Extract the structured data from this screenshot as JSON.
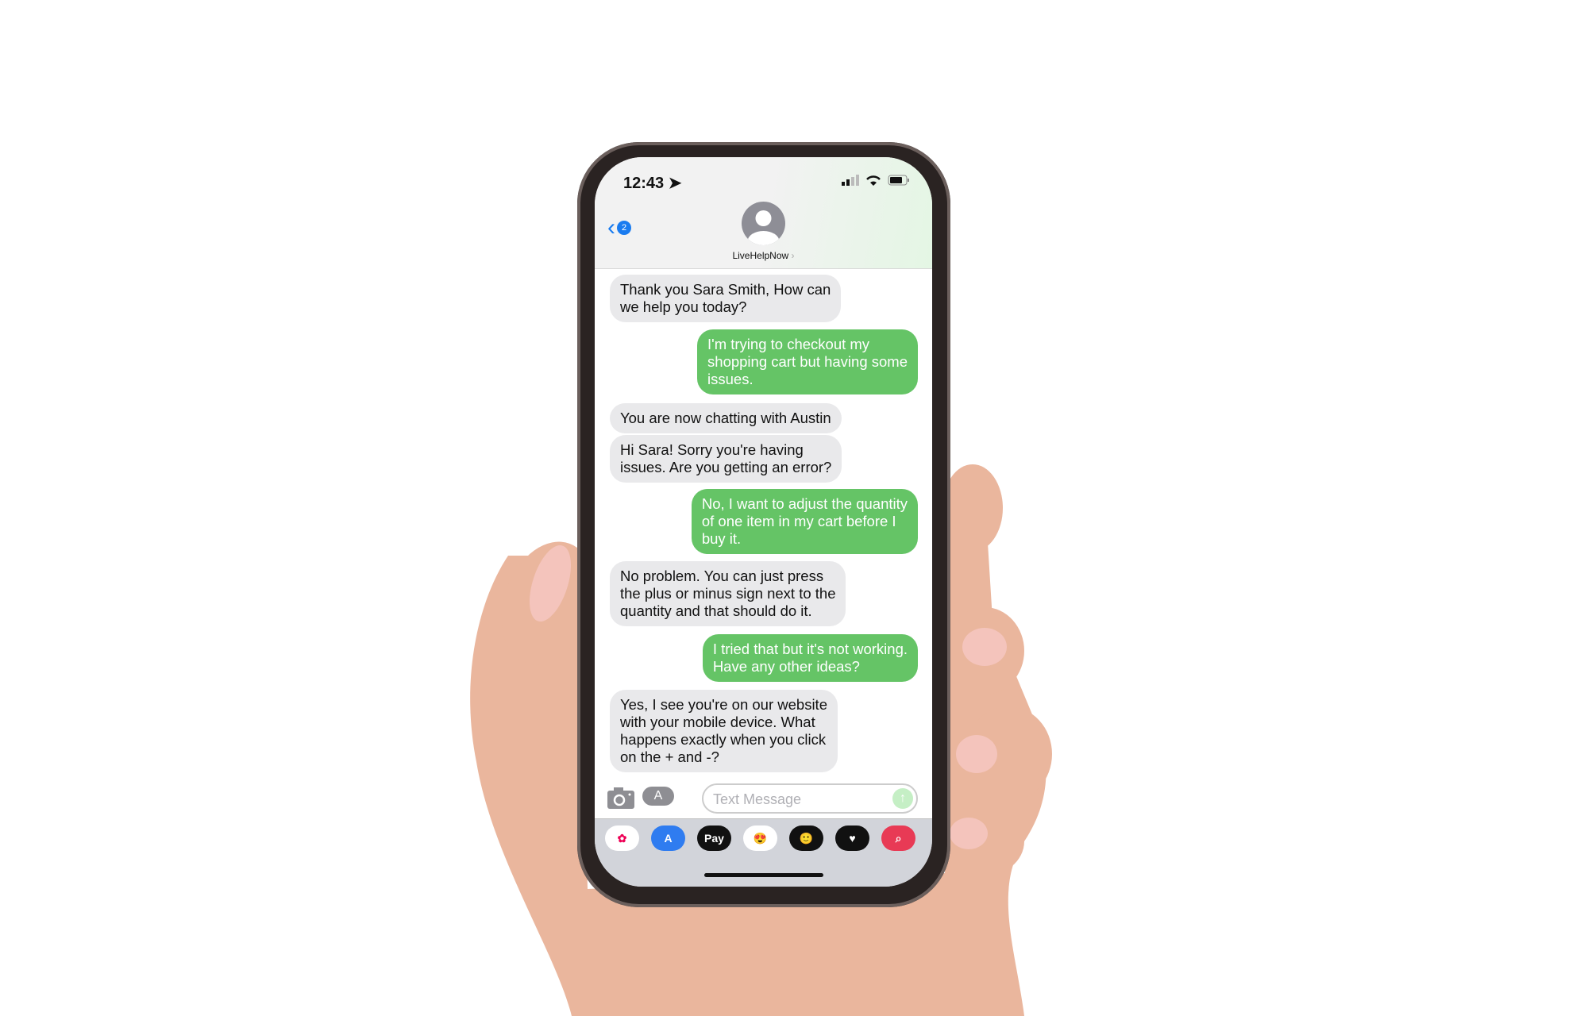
{
  "status_bar": {
    "time": "12:43"
  },
  "header": {
    "back_badge": "2",
    "contact_name": "LiveHelpNow",
    "chevron": "›"
  },
  "messages": [
    {
      "from": "them",
      "lines": [
        "Thank you Sara Smith, How can",
        "we help you today?"
      ]
    },
    {
      "from": "me",
      "lines": [
        "I'm trying to checkout my",
        "shopping cart but having some",
        "issues."
      ]
    },
    {
      "from": "them",
      "lines": [
        "You are now chatting with Austin"
      ]
    },
    {
      "from": "them",
      "lines": [
        "Hi Sara! Sorry you're having",
        "issues. Are you getting an error?"
      ]
    },
    {
      "from": "me",
      "lines": [
        "No, I want to adjust the quantity",
        "of one item in my cart before I",
        "buy it."
      ]
    },
    {
      "from": "them",
      "lines": [
        "No problem. You can just press",
        "the plus or minus sign next to the",
        "quantity and that should do it."
      ]
    },
    {
      "from": "me",
      "lines": [
        "I tried that but it's not working.",
        "Have any other ideas?"
      ]
    },
    {
      "from": "them",
      "lines": [
        "Yes, I see you're on our website",
        "with your mobile device. What",
        "happens exactly when you click",
        "on the + and -?"
      ]
    }
  ],
  "compose": {
    "placeholder": "Text Message",
    "send_icon": "arrow-up-icon",
    "camera_icon": "camera-icon",
    "apps_icon": "app-store-icon"
  },
  "app_strip": [
    {
      "name": "photos",
      "label": "✿",
      "color": "#ffffff"
    },
    {
      "name": "app-store",
      "label": "A",
      "color": "#2f7cf0"
    },
    {
      "name": "apple-pay",
      "label": "Pay",
      "color": "#111111"
    },
    {
      "name": "memoji-stickers",
      "label": "😍",
      "color": "#ffffff"
    },
    {
      "name": "animoji",
      "label": "🙂",
      "color": "#111111"
    },
    {
      "name": "digital-touch",
      "label": "♥",
      "color": "#111111"
    },
    {
      "name": "images-search",
      "label": "⌕",
      "color": "#e83a55"
    }
  ],
  "colors": {
    "sent": "#65c466",
    "received": "#e9e9eb",
    "accent": "#1a7cf0"
  }
}
